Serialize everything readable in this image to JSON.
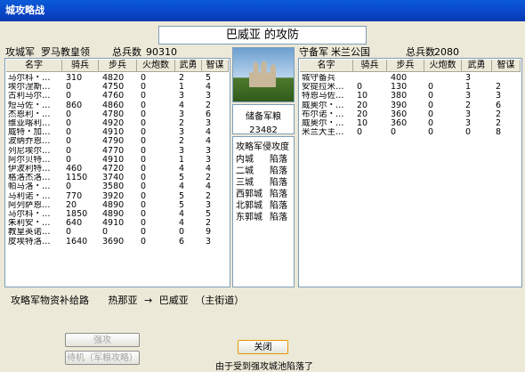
{
  "window": {
    "title": "城攻略战"
  },
  "banner": "巴威亚 的攻防",
  "attacker": {
    "label": "攻城军",
    "commander": "罗马教皇领",
    "total_label": "总兵数",
    "total": "90310",
    "columns": [
      "名字",
      "骑兵",
      "步兵",
      "火炮数",
      "武勇",
      "智谋"
    ],
    "rows": [
      [
        "马尔科・…",
        "310",
        "4820",
        "0",
        "2",
        "5"
      ],
      [
        "埃尔涅斯…",
        "0",
        "4750",
        "0",
        "1",
        "4"
      ],
      [
        "古利马尔…",
        "0",
        "4760",
        "0",
        "3",
        "3"
      ],
      [
        "短马佐・…",
        "860",
        "4860",
        "0",
        "4",
        "2"
      ],
      [
        "杰恩利・…",
        "0",
        "4780",
        "0",
        "3",
        "6"
      ],
      [
        "维亚喀利…",
        "0",
        "4920",
        "0",
        "2",
        "3"
      ],
      [
        "威特・加…",
        "0",
        "4910",
        "0",
        "3",
        "4"
      ],
      [
        "波纳乔恩…",
        "0",
        "4790",
        "0",
        "2",
        "4"
      ],
      [
        "列尼埃尔…",
        "0",
        "4770",
        "0",
        "3",
        "3"
      ],
      [
        "阿尔贝特…",
        "0",
        "4910",
        "0",
        "1",
        "3"
      ],
      [
        "伊波利特…",
        "460",
        "4720",
        "0",
        "4",
        "4"
      ],
      [
        "格洛杰洛…",
        "1150",
        "3740",
        "0",
        "5",
        "2"
      ],
      [
        "帕马洛・…",
        "0",
        "3580",
        "0",
        "4",
        "4"
      ],
      [
        "马利诺・…",
        "770",
        "3920",
        "0",
        "5",
        "2"
      ],
      [
        "阿列萨恩…",
        "20",
        "4890",
        "0",
        "5",
        "3"
      ],
      [
        "马尔科・…",
        "1850",
        "4890",
        "0",
        "4",
        "5"
      ],
      [
        "朱利安・…",
        "640",
        "4910",
        "0",
        "4",
        "2"
      ],
      [
        "教皇英诺…",
        "0",
        "0",
        "0",
        "0",
        "9"
      ],
      [
        "皮埃特洛…",
        "1640",
        "3690",
        "0",
        "6",
        "3"
      ]
    ]
  },
  "defender": {
    "label": "守备军",
    "commander": "米兰公国",
    "total_label": "总兵数",
    "total": "2080",
    "columns": [
      "名字",
      "骑兵",
      "步兵",
      "火炮数",
      "武勇",
      "智谋"
    ],
    "rows": [
      [
        "城守备兵",
        "",
        "400",
        "",
        "3",
        ""
      ],
      [
        "安提拉米…",
        "0",
        "130",
        "0",
        "1",
        "2"
      ],
      [
        "特恩马佐…",
        "10",
        "380",
        "0",
        "3",
        "3"
      ],
      [
        "威奥尔・…",
        "20",
        "390",
        "0",
        "2",
        "6"
      ],
      [
        "布尔诺・…",
        "20",
        "360",
        "0",
        "3",
        "2"
      ],
      [
        "威奥尔・…",
        "10",
        "360",
        "0",
        "3",
        "2"
      ],
      [
        "米兰大主…",
        "0",
        "0",
        "0",
        "0",
        "8"
      ]
    ]
  },
  "reserve": {
    "label": "储备军粮",
    "value": "23482"
  },
  "invasion": {
    "title": "攻略军侵攻度",
    "rows": [
      [
        "内城",
        "陷落"
      ],
      [
        "二城",
        "陷落"
      ],
      [
        "三城",
        "陷落"
      ],
      [
        "西郭城",
        "陷落"
      ],
      [
        "北郭城",
        "陷落"
      ],
      [
        "东郭城",
        "陷落"
      ]
    ]
  },
  "supply_route": {
    "label": "攻略军物资补给路",
    "from": "热那亚",
    "arrow": "→",
    "to": "巴威亚",
    "note": "（主街道）"
  },
  "buttons": {
    "attack": "强攻",
    "wait": "待机（军粮攻略）",
    "close": "关闭"
  },
  "status": "由于受到强攻城池陷落了"
}
